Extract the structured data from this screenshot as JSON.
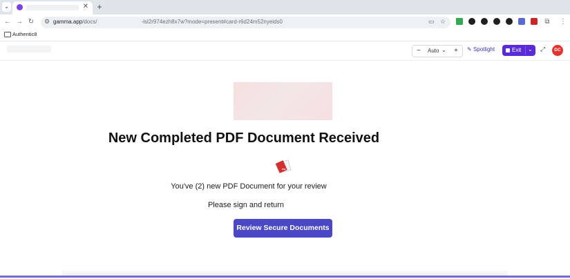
{
  "browser": {
    "tab": {
      "title": ""
    },
    "address": {
      "host": "gamma.app",
      "path_start": "/docs/",
      "path_end": "-lsl2r974ezh8x7w?mode=present#card-r6d24m52nyeids0"
    },
    "bookmark": {
      "label": "Authentic8"
    }
  },
  "app_header": {
    "zoom_label": "Auto",
    "spotlight_label": "Spotlight",
    "exit_label": "Exit",
    "avatar_initials": "DC",
    "accent": "#5b2bd9",
    "avatar_color": "#e5322d"
  },
  "card": {
    "title": "New Completed PDF Document Received",
    "message": "You've (2) new PDF Document for your review",
    "instruction": "Please sign and return",
    "cta_label": "Review Secure Documents",
    "cta_color": "#4b48c5",
    "icon": "pdf-file-icon",
    "pdf_badge": "PDF"
  },
  "presentation": {
    "progress_fraction": 1.0
  }
}
